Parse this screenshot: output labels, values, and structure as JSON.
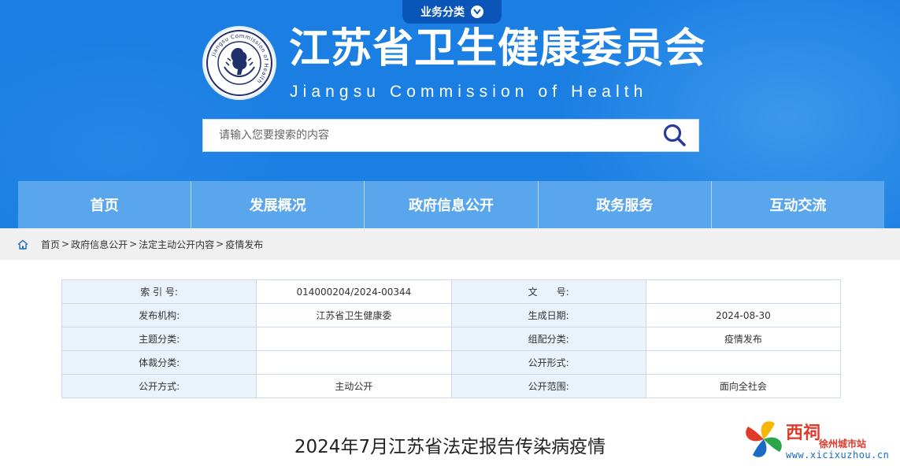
{
  "header": {
    "biz_tab_label": "业务分类",
    "title_cn": "江苏省卫生健康委员会",
    "title_en": "Jiangsu Commission of Health",
    "emblem_text": "Jiangsu Commission of Health"
  },
  "search": {
    "placeholder": "请输入您要搜索的内容"
  },
  "nav": {
    "items": [
      "首页",
      "发展概况",
      "政府信息公开",
      "政务服务",
      "互动交流"
    ]
  },
  "breadcrumb": {
    "items": [
      "首页",
      "政府信息公开",
      "法定主动公开内容",
      "疫情发布"
    ],
    "separator": ">"
  },
  "meta_table": {
    "rows": [
      {
        "k1": "索 引 号:",
        "v1": "014000204/2024-00344",
        "k2": "文　　号:",
        "v2": ""
      },
      {
        "k1": "发布机构:",
        "v1": "江苏省卫生健康委",
        "k2": "生成日期:",
        "v2": "2024-08-30"
      },
      {
        "k1": "主题分类:",
        "v1": "",
        "k2": "组配分类:",
        "v2": "疫情发布"
      },
      {
        "k1": "体裁分类:",
        "v1": "",
        "k2": "公开形式:",
        "v2": ""
      },
      {
        "k1": "公开方式:",
        "v1": "主动公开",
        "k2": "公开范围:",
        "v2": "面向全社会"
      }
    ]
  },
  "article": {
    "title": "2024年7月江苏省法定报告传染病疫情"
  },
  "watermark": {
    "name": "西祠",
    "sub": "徐州城市站",
    "url": "www.xicixuzhou.cn"
  },
  "colors": {
    "header_bg": "#1a7ee2",
    "nav_bg": "#5aa6ec",
    "biz_tab_bg": "#0a55b8",
    "table_key_bg": "#eaf2fb",
    "search_icon": "#2a3a9a"
  }
}
